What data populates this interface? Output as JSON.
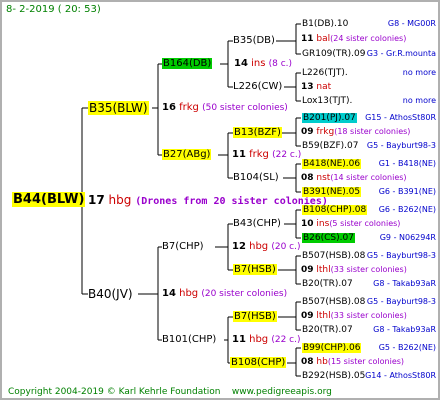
{
  "header": {
    "date": "8- 2-2019 ( 20: 53)"
  },
  "footer": {
    "copyright": "Copyright 2004-2019 © Karl Kehrle Foundation",
    "site": "www.pedigreeapis.org"
  },
  "root": {
    "name": "B44(BLW)",
    "num": "17",
    "breed": "hbg",
    "note": "(Drones from 20 sister colonies)"
  },
  "l1": [
    {
      "name": "B35(BLW)",
      "num": "16",
      "breed": "frkg",
      "note": "(50 sister colonies)"
    },
    {
      "name": "B40(JV)",
      "num": "14",
      "breed": "hbg",
      "note": "(20 sister colonies)"
    }
  ],
  "l2": [
    {
      "name": "B164(DB)",
      "num": "14",
      "breed": "ins",
      "note": "(8 c.)"
    },
    {
      "name": "B27(ABg)",
      "num": "11",
      "breed": "frkg",
      "note": "(22 c.)"
    },
    {
      "name": "B7(CHP)",
      "num": "12",
      "breed": "hbg",
      "note": "(20 c.)"
    },
    {
      "name": "B101(CHP)",
      "num": "11",
      "breed": "hbg",
      "note": "(22 c.)"
    }
  ],
  "l3": [
    {
      "name": "B35(DB)",
      "num": "11",
      "breed": "bal",
      "note": "(24 sister colonies)"
    },
    {
      "name": "L226(CW)",
      "num": "13",
      "breed": "nat",
      "note": ""
    },
    {
      "name": "B13(BZF)",
      "num": "09",
      "breed": "frkg",
      "note": "(18 sister colonies)"
    },
    {
      "name": "B104(SL)",
      "num": "08",
      "breed": "nst",
      "note": "(14 sister colonies)"
    },
    {
      "name": "B43(CHP)",
      "num": "10",
      "breed": "ins",
      "note": "(5 sister colonies)"
    },
    {
      "name": "B7(HSB)",
      "num": "09",
      "breed": "lthl",
      "note": "(33 sister colonies)"
    },
    {
      "name": "B7(HSB)",
      "num": "09",
      "breed": "lthl",
      "note": "(33 sister colonies)"
    },
    {
      "name": "B108(CHP)",
      "num": "08",
      "breed": "hb",
      "note": "(15 sister colonies)"
    }
  ],
  "l4": [
    {
      "name": "B1(DB).10",
      "ref": "G8 - MG00R"
    },
    {
      "name": "GR109(TR).09",
      "ref": "G3 - Gr.R.mounta"
    },
    {
      "name": "L226(TJT).",
      "ref": "no more"
    },
    {
      "name": "Lox13(TJT).",
      "ref": "no more"
    },
    {
      "name": "B201(PJ).07",
      "ref": "G15 - AthosSt80R"
    },
    {
      "name": "B59(BZF).07",
      "ref": "G5 - Bayburt98-3"
    },
    {
      "name": "B418(NE).06",
      "ref": "G1 - B418(NE)"
    },
    {
      "name": "B391(NE).05",
      "ref": "G6 - B391(NE)"
    },
    {
      "name": "B108(CHP).08",
      "ref": "G6 - B262(NE)"
    },
    {
      "name": "B26(CS).07",
      "ref": "G9 - N06294R"
    },
    {
      "name": "B507(HSB).08",
      "ref": "G5 - Bayburt98-3"
    },
    {
      "name": "B20(TR).07",
      "ref": "G8 - Takab93aR"
    },
    {
      "name": "B507(HSB).08",
      "ref": "G5 - Bayburt98-3"
    },
    {
      "name": "B20(TR).07",
      "ref": "G8 - Takab93aR"
    },
    {
      "name": "B99(CHP).06",
      "ref": "G5 - B262(NE)"
    },
    {
      "name": "B292(HSB).05",
      "ref": "G14 - AthosSt80R"
    }
  ]
}
